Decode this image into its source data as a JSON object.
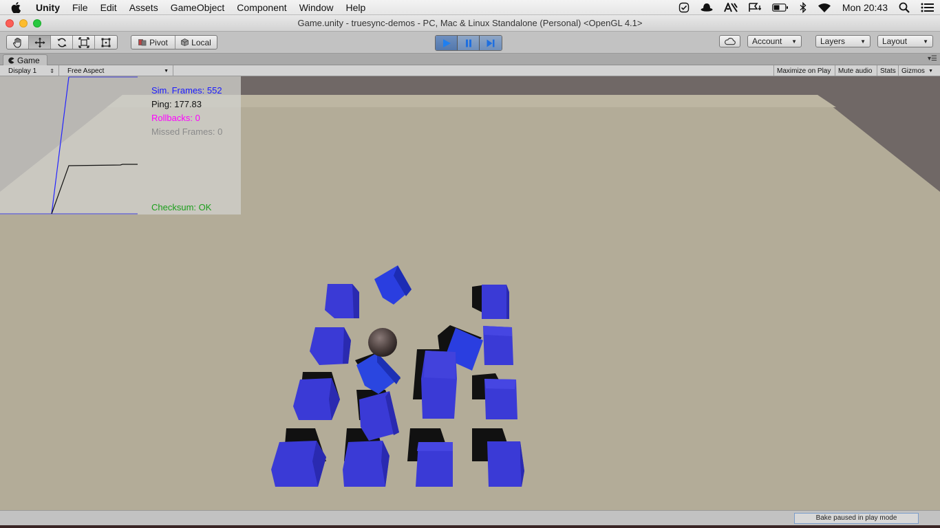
{
  "menubar": {
    "app_name": "Unity",
    "items": [
      "File",
      "Edit",
      "Assets",
      "GameObject",
      "Component",
      "Window",
      "Help"
    ],
    "clock": "Mon 20:43"
  },
  "window": {
    "title": "Game.unity - truesync-demos - PC, Mac & Linux Standalone (Personal) <OpenGL 4.1>"
  },
  "toolbar": {
    "tools": [
      "hand-icon",
      "move-icon",
      "rotate-icon",
      "scale-icon",
      "rect-transform-icon"
    ],
    "active_tool": "move-icon",
    "pivot_label": "Pivot",
    "local_label": "Local",
    "play_state": "playing",
    "account_label": "Account",
    "layers_label": "Layers",
    "layout_label": "Layout"
  },
  "game_tab": {
    "label": "Game",
    "display": "Display 1",
    "aspect": "Free Aspect",
    "maximize_label": "Maximize on Play",
    "mute_label": "Mute audio",
    "stats_label": "Stats",
    "gizmos_label": "Gizmos"
  },
  "overlay": {
    "sim_frames": "Sim. Frames: 552",
    "ping": "Ping: 177.83",
    "rollbacks": "Rollbacks: 0",
    "missed_frames": "Missed Frames: 0",
    "checksum": "Checksum: OK",
    "colors": {
      "sim_frames": "#1a1aff",
      "ping": "#111111",
      "rollbacks": "#ff00ff",
      "missed_frames": "#8a8a8a",
      "checksum": "#1a9e1a"
    }
  },
  "status": {
    "bake": "Bake paused in play mode"
  },
  "colors": {
    "cube": "#3a3ad6",
    "floor": "#b3ac98",
    "wall": "#706866"
  }
}
